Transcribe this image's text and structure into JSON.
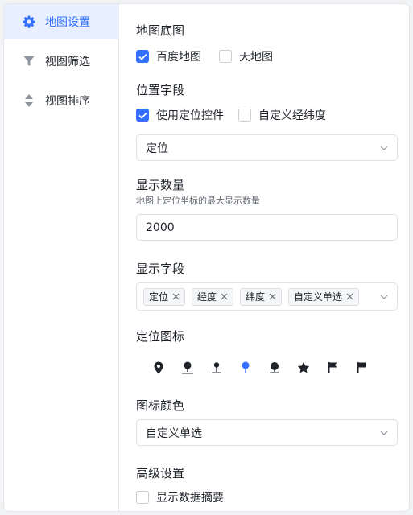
{
  "sidebar": {
    "items": [
      {
        "label": "地图设置",
        "icon": "gear-icon",
        "active": true
      },
      {
        "label": "视图筛选",
        "icon": "filter-icon",
        "active": false
      },
      {
        "label": "视图排序",
        "icon": "sort-icon",
        "active": false
      }
    ]
  },
  "basemap": {
    "title": "地图底图",
    "options": [
      {
        "label": "百度地图",
        "checked": true
      },
      {
        "label": "天地图",
        "checked": false
      }
    ]
  },
  "location": {
    "title": "位置字段",
    "options": [
      {
        "label": "使用定位控件",
        "checked": true
      },
      {
        "label": "自定义经纬度",
        "checked": false
      }
    ],
    "select_value": "定位"
  },
  "count": {
    "title": "显示数量",
    "hint": "地图上定位坐标的最大显示数量",
    "value": "2000"
  },
  "display_fields": {
    "title": "显示字段",
    "tags": [
      "定位",
      "经度",
      "纬度",
      "自定义单选"
    ]
  },
  "marker_icon": {
    "title": "定位图标",
    "icons": [
      "map-pin-icon",
      "pushpin-icon",
      "pushpin-small-icon",
      "pin-selected-icon",
      "pushpin-round-icon",
      "star-icon",
      "flag-icon",
      "flag-filled-icon"
    ],
    "selected_index": 3,
    "accent": "#3370ff"
  },
  "icon_color": {
    "title": "图标颜色",
    "select_value": "自定义单选"
  },
  "advanced": {
    "title": "高级设置",
    "options": [
      {
        "label": "显示数据摘要",
        "checked": false
      }
    ]
  }
}
